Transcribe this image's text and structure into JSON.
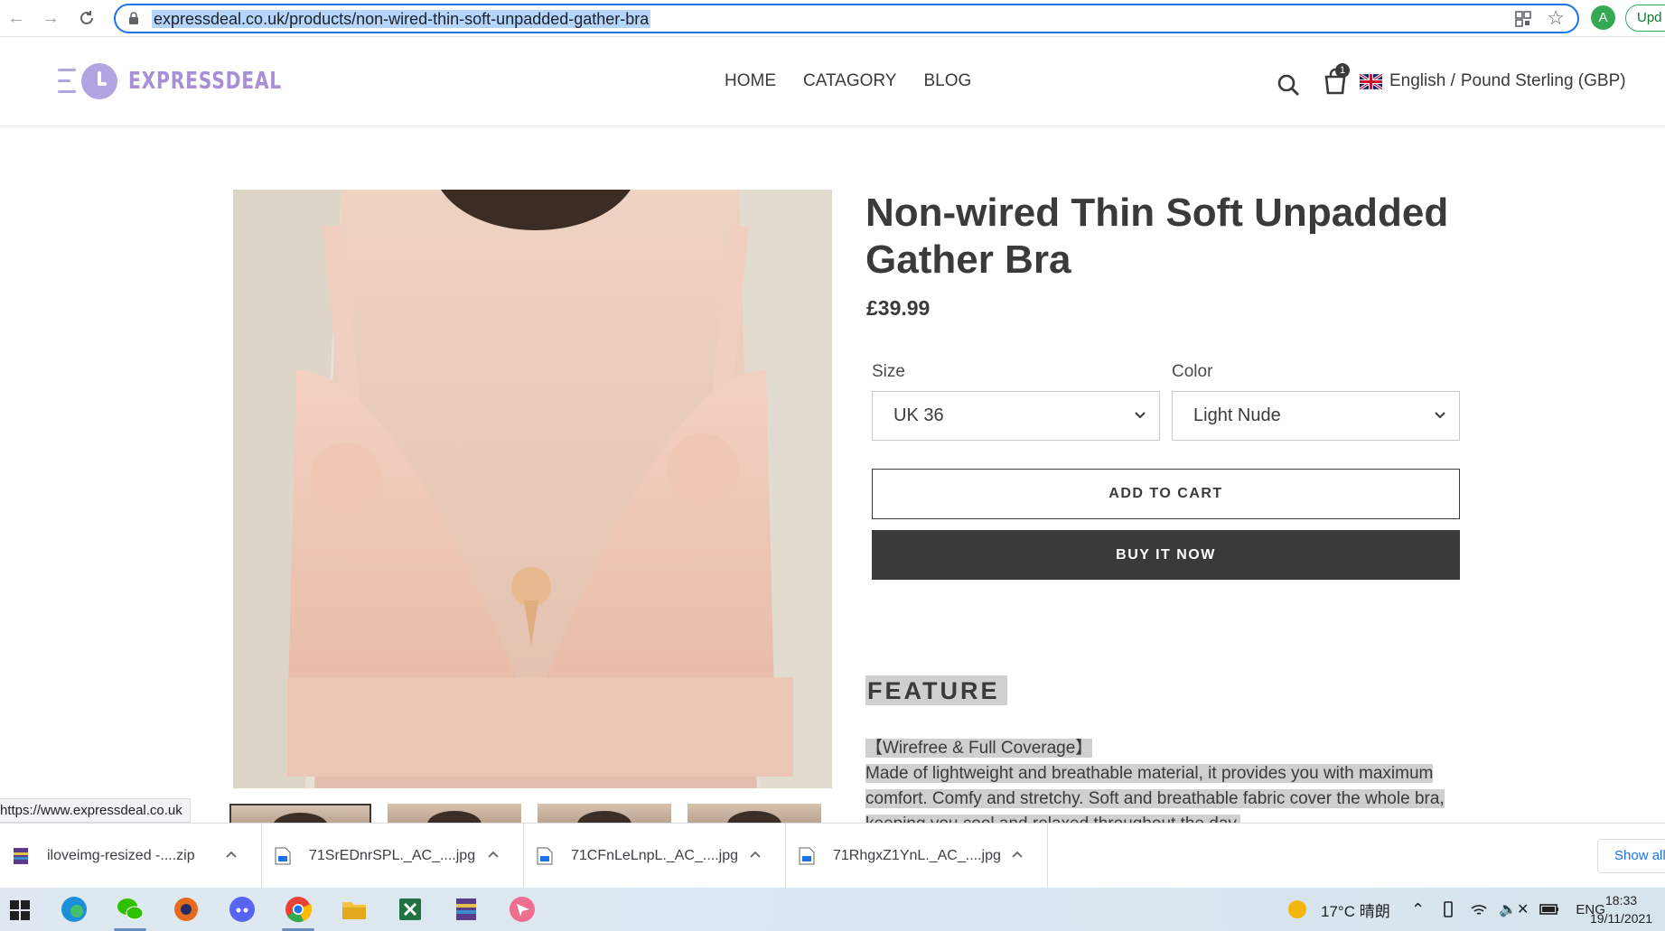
{
  "browser": {
    "url": "expressdeal.co.uk/products/non-wired-thin-soft-unpadded-gather-bra",
    "profile_initial": "A",
    "update_label": "Upd"
  },
  "header": {
    "logo_text": "EXPRESSDEAL",
    "nav": [
      "HOME",
      "CATAGORY",
      "BLOG"
    ],
    "cart_count": "1",
    "language": "English /",
    "currency": "Pound Sterling (GBP)"
  },
  "product": {
    "title_line1": "Non-wired Thin Soft Unpadded",
    "title_line2": "Gather Bra",
    "price": "£39.99",
    "size_label": "Size",
    "size_value": "UK 36",
    "color_label": "Color",
    "color_value": "Light Nude",
    "add_to_cart": "ADD TO CART",
    "buy_now": "BUY IT NOW",
    "feature_heading": "FEATURE",
    "feature_title": "【Wirefree & Full Coverage】",
    "feature_line1": "Made of lightweight and breathable material, it provides you with maximum",
    "feature_line2": "comfort. Comfy and stretchy. Soft and breathable fabric cover the whole bra,",
    "feature_line3": "keeping you cool and relaxed throughout the day."
  },
  "status_link": "https://www.expressdeal.co.uk",
  "downloads": {
    "items": [
      "iloveimg-resized -....zip",
      "71SrEDnrSPL._AC_....jpg",
      "71CFnLeLnpL._AC_....jpg",
      "71RhgxZ1YnL._AC_....jpg"
    ],
    "show_all": "Show all"
  },
  "taskbar": {
    "weather": "17°C 晴朗",
    "lang": "ENG",
    "time": "18:33",
    "date": "19/11/2021"
  },
  "colors": {
    "accent_blue": "#1a73e8",
    "text_dark": "#3a3a3a",
    "logo_purple": "#a98ed8"
  }
}
